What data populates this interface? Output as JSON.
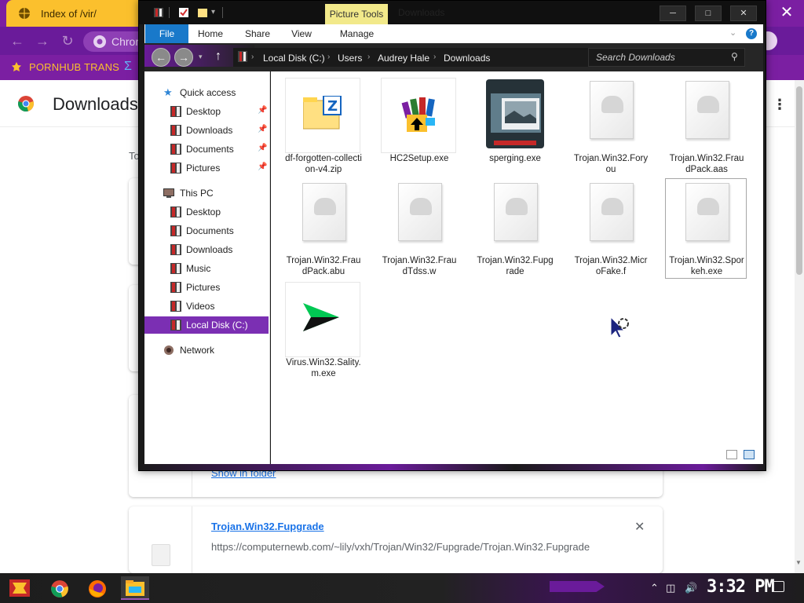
{
  "chrome": {
    "tab_title": "Index of /vir/",
    "close_glyph": "✕",
    "omnibox_text": "Chror",
    "bookmark_label": "PORNHUB TRANS",
    "downloads_title": "Downloads",
    "today_label": "To",
    "show_in_folder": "Show in folder",
    "download_item": {
      "name": "Trojan.Win32.Fupgrade",
      "url": "https://computernewb.com/~lily/vxh/Trojan/Win32/Fupgrade/Trojan.Win32.Fupgrade"
    },
    "colors": {
      "tabbar": "#7b1fa2",
      "tab": "#fbc02d",
      "link": "#1a73e8"
    }
  },
  "explorer": {
    "window_title": "Downloads",
    "picture_tools": "Picture Tools",
    "ribbon_tabs": [
      "File",
      "Home",
      "Share",
      "View",
      "Manage"
    ],
    "breadcrumb": [
      "Local Disk (C:)",
      "Users",
      "Audrey Hale",
      "Downloads"
    ],
    "search_placeholder": "Search Downloads",
    "nav": {
      "quick_access": "Quick access",
      "quick_items": [
        "Desktop",
        "Downloads",
        "Documents",
        "Pictures"
      ],
      "this_pc": "This PC",
      "pc_items": [
        "Desktop",
        "Documents",
        "Downloads",
        "Music",
        "Pictures",
        "Videos"
      ],
      "local_disk": "Local Disk (C:)",
      "network": "Network"
    },
    "files": [
      {
        "name": "df-forgotten-collection-v4.zip",
        "icon": "zip-archive-icon"
      },
      {
        "name": "HC2Setup.exe",
        "icon": "installer-icon"
      },
      {
        "name": "sperging.exe",
        "icon": "app-window-icon"
      },
      {
        "name": "Trojan.Win32.Foryou",
        "icon": "blank-file-icon"
      },
      {
        "name": "Trojan.Win32.FraudPack.aas",
        "icon": "blank-file-icon"
      },
      {
        "name": "Trojan.Win32.FraudPack.abu",
        "icon": "blank-file-icon"
      },
      {
        "name": "Trojan.Win32.FraudTdss.w",
        "icon": "blank-file-icon"
      },
      {
        "name": "Trojan.Win32.Fupgrade",
        "icon": "blank-file-icon"
      },
      {
        "name": "Trojan.Win32.MicroFake.f",
        "icon": "blank-file-icon"
      },
      {
        "name": "Trojan.Win32.Sporkeh.exe",
        "icon": "blank-file-icon"
      },
      {
        "name": "Virus.Win32.Sality.m.exe",
        "icon": "green-arrow-icon"
      }
    ],
    "window_buttons": {
      "minimize": "─",
      "maximize": "□",
      "close": "✕"
    },
    "colors": {
      "accent": "#7b2fb3",
      "ribbon_active": "#1979ca",
      "picture_tools_bg": "#f2e98a"
    }
  },
  "taskbar": {
    "clock": "3:32 PM"
  }
}
